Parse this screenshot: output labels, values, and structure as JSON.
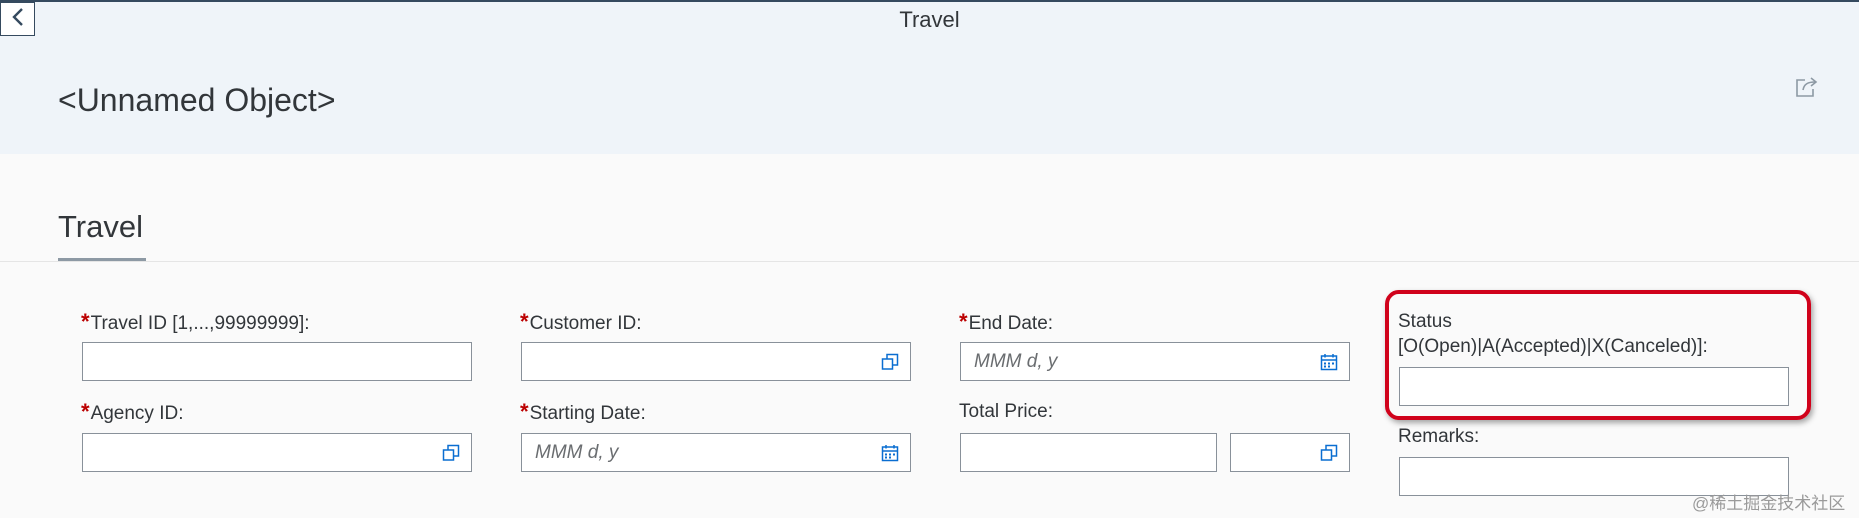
{
  "nav": {
    "title": "Travel"
  },
  "header": {
    "object_title": "<Unnamed Object>"
  },
  "section": {
    "tab_label": "Travel"
  },
  "form": {
    "travel_id": {
      "label": "Travel ID [1,...,99999999]:",
      "required": "*",
      "value": ""
    },
    "agency_id": {
      "label": "Agency ID:",
      "required": "*",
      "value": ""
    },
    "customer_id": {
      "label": "Customer ID:",
      "required": "*",
      "value": ""
    },
    "starting_date": {
      "label": "Starting Date:",
      "required": "*",
      "placeholder": "MMM d, y"
    },
    "end_date": {
      "label": "End Date:",
      "required": "*",
      "placeholder": "MMM d, y"
    },
    "total_price": {
      "label": "Total Price:",
      "value": "",
      "currency": ""
    },
    "status": {
      "label_line1": "Status",
      "label_line2": "[O(Open)|A(Accepted)|X(Canceled)]:",
      "value": ""
    },
    "remarks": {
      "label": "Remarks:",
      "value": ""
    }
  },
  "icons": {
    "back": "chevron-left-icon",
    "share": "share-icon",
    "value_help": "value-help-icon",
    "calendar": "calendar-icon"
  },
  "colors": {
    "header_bg": "#eff4f9",
    "required": "#bb0000",
    "highlight": "#d0021b"
  },
  "watermark": "@稀土掘金技术社区"
}
